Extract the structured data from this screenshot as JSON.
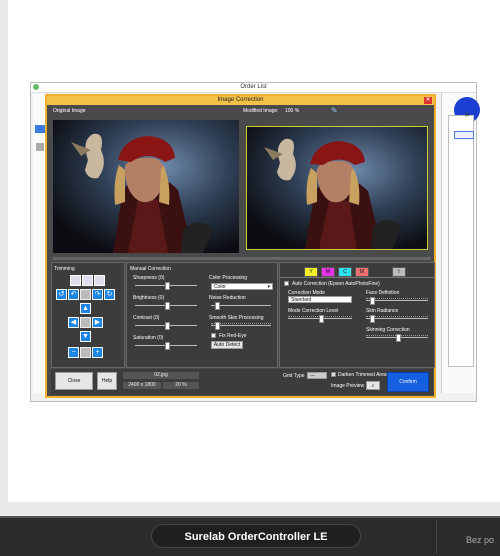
{
  "background_window": {
    "title": "Order List"
  },
  "dialog": {
    "title": "Image Correction",
    "original_label": "Original Image",
    "modified_label": "Modified Image:",
    "zoom": "100 %"
  },
  "trimming": {
    "label": "Trimming"
  },
  "manual": {
    "label": "Manual Correction",
    "sharpness": "Sharpness (0)",
    "brightness": "Brightness (0)",
    "contrast": "Contrast (0)",
    "saturation": "Saturation (0)",
    "color_processing_label": "Color Processing",
    "color_processing_value": "Color",
    "noise_reduction": "Noise Reduction",
    "smooth_skin": "Smooth Skin Processing",
    "fix_red_eye": "Fix Red-Eye",
    "auto_detect": "Auto Detect"
  },
  "color_buttons": [
    {
      "label": "Y",
      "color": "#f5f02a"
    },
    {
      "label": "M",
      "color": "#e830e8"
    },
    {
      "label": "C",
      "color": "#30e0f0"
    },
    {
      "label": "M",
      "color": "#f07070"
    },
    {
      "label": "I",
      "color": "#bbbbbb"
    }
  ],
  "auto": {
    "auto_correction": "Auto Correction (Epson AutoPhotoFine)",
    "correction_mode_label": "Correction Mode",
    "correction_mode_value": "Standard",
    "mode_level": "Mode Correction Level",
    "face_definition": "Face Definition",
    "skin_radiance": "Skin Radiance",
    "skinning_correction": "Skinning Correction"
  },
  "bottom": {
    "close": "Close",
    "help": "Help",
    "filename": "02.jpg",
    "dimensions": "2400 x 1800",
    "percent": "20 %",
    "grid_type": "Grid Type",
    "grid_value": "---",
    "darken_trim": "Darken Trimmed Area",
    "image_preview": "Image Preview",
    "confirm": "Confirm"
  },
  "taskbar": {
    "tooltip": "Surelab OrderController LE",
    "system_text": "Bez po"
  }
}
